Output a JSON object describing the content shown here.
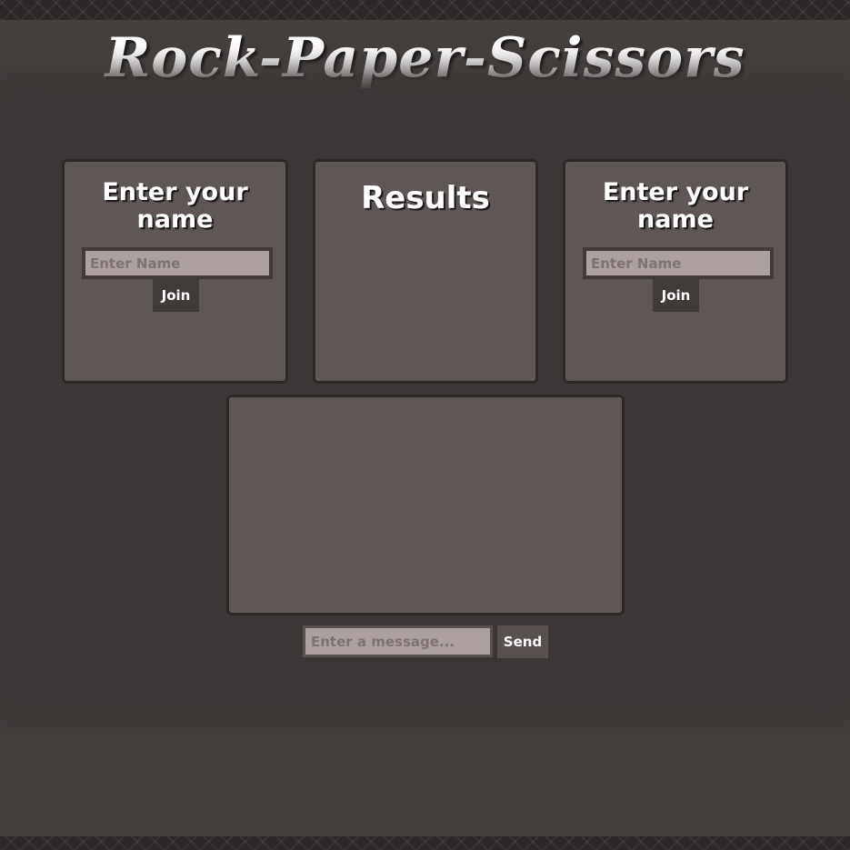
{
  "header": {
    "title": "Rock-Paper-Scissors"
  },
  "player_left": {
    "heading": "Enter your name",
    "name_placeholder": "Enter Name",
    "join_label": "Join"
  },
  "results": {
    "heading": "Results"
  },
  "player_right": {
    "heading": "Enter your name",
    "name_placeholder": "Enter Name",
    "join_label": "Join"
  },
  "chat": {
    "message_placeholder": "Enter a message...",
    "send_label": "Send"
  },
  "colors": {
    "page_background": "#45403e",
    "panel_background": "#3c3736",
    "card_background": "#5f5756",
    "input_background": "#ada19f",
    "button_background": "#403a39",
    "text": "#ffffff"
  }
}
